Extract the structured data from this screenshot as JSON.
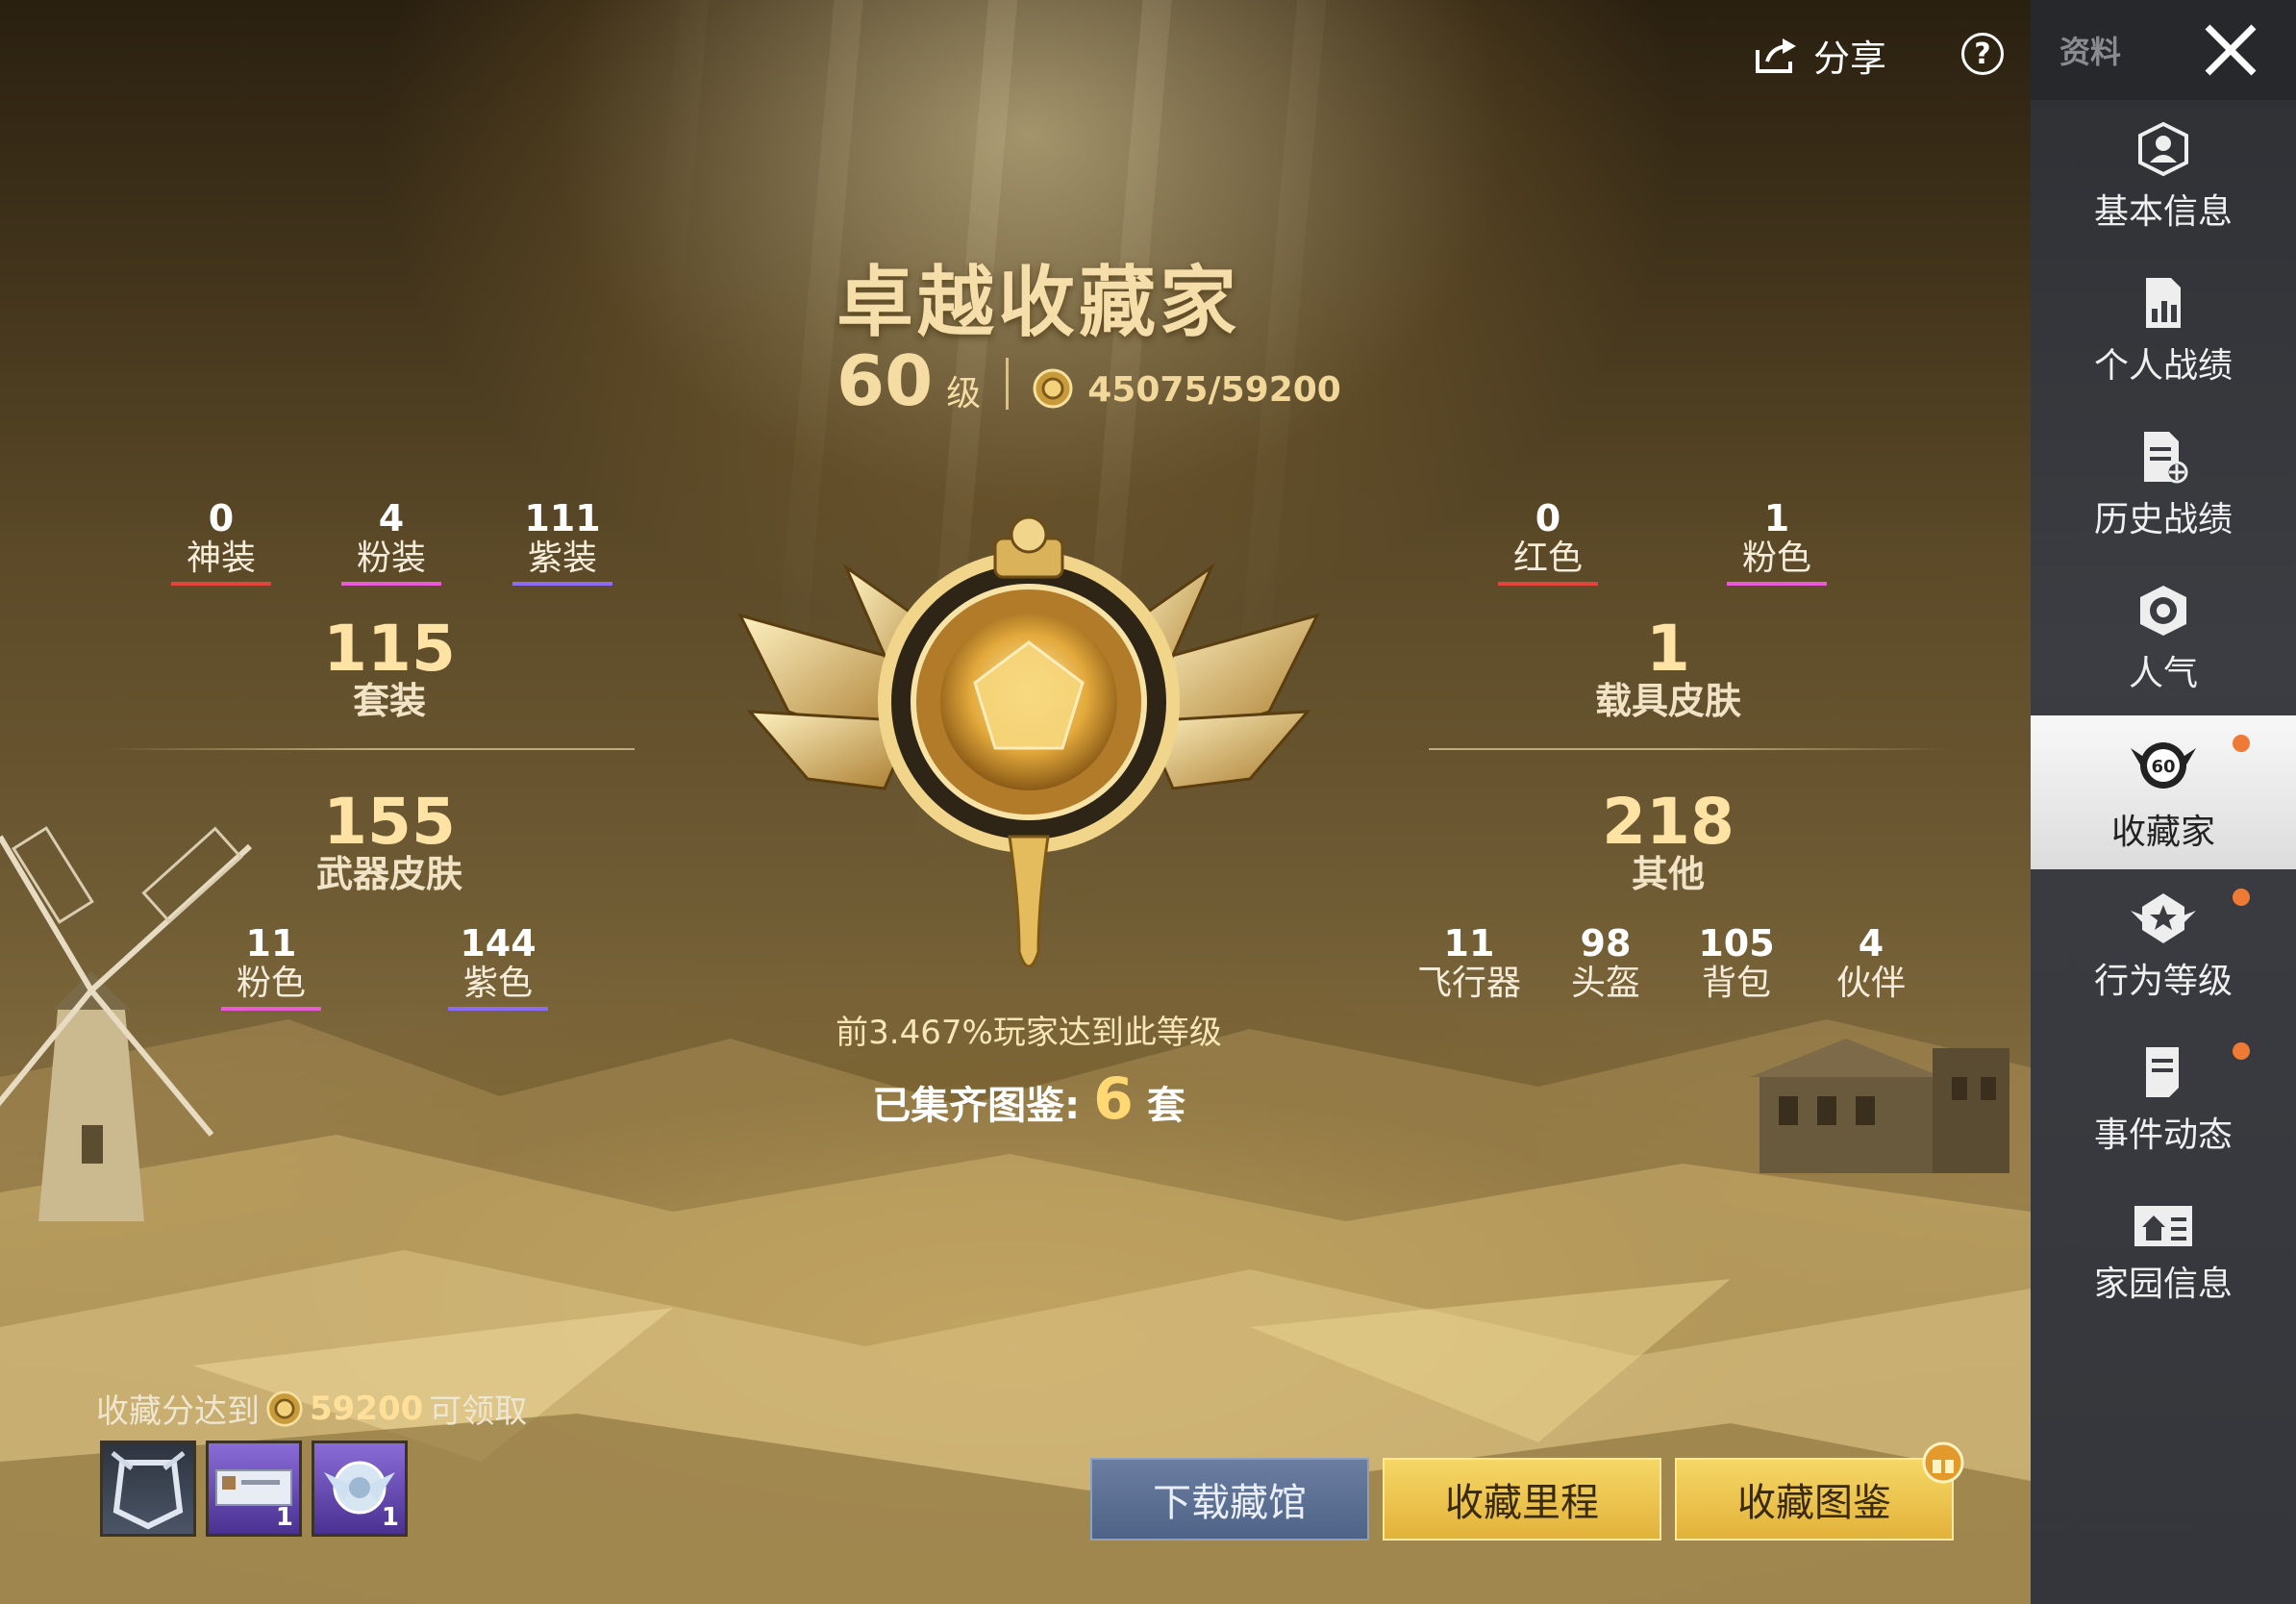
{
  "header": {
    "share_label": "分享",
    "help_label": "?"
  },
  "sidebar": {
    "top_label": "资料",
    "items": [
      {
        "label": "基本信息",
        "icon": "user-shield-icon",
        "active": false,
        "dot": false
      },
      {
        "label": "个人战绩",
        "icon": "stats-doc-icon",
        "active": false,
        "dot": false
      },
      {
        "label": "历史战绩",
        "icon": "history-doc-icon",
        "active": false,
        "dot": false
      },
      {
        "label": "人气",
        "icon": "popularity-icon",
        "active": false,
        "dot": false
      },
      {
        "label": "收藏家",
        "icon": "collector-badge-icon",
        "badge_num": "60",
        "active": true,
        "dot": true
      },
      {
        "label": "行为等级",
        "icon": "behavior-star-icon",
        "active": false,
        "dot": true
      },
      {
        "label": "事件动态",
        "icon": "event-doc-icon",
        "active": false,
        "dot": true
      },
      {
        "label": "家园信息",
        "icon": "home-icon",
        "active": false,
        "dot": false
      }
    ]
  },
  "main": {
    "title": "卓越收藏家",
    "level_num": "60",
    "level_unit": "级",
    "score": "45075/59200",
    "left": {
      "top_stats": [
        {
          "num": "0",
          "label": "神装",
          "color": "#e2453c"
        },
        {
          "num": "4",
          "label": "粉装",
          "color": "#e85ad6"
        },
        {
          "num": "111",
          "label": "紫装",
          "color": "#8b6cf2"
        }
      ],
      "suit": {
        "num": "115",
        "label": "套装"
      },
      "weapon": {
        "num": "155",
        "label": "武器皮肤"
      },
      "weapon_stats": [
        {
          "num": "11",
          "label": "粉色",
          "color": "#e85ad6"
        },
        {
          "num": "144",
          "label": "紫色",
          "color": "#8b6cf2"
        }
      ]
    },
    "right": {
      "top_stats": [
        {
          "num": "0",
          "label": "红色",
          "color": "#e2453c"
        },
        {
          "num": "1",
          "label": "粉色",
          "color": "#e85ad6"
        }
      ],
      "vehicle": {
        "num": "1",
        "label": "载具皮肤"
      },
      "other": {
        "num": "218",
        "label": "其他"
      },
      "other_stats": [
        {
          "num": "11",
          "label": "飞行器"
        },
        {
          "num": "98",
          "label": "头盔"
        },
        {
          "num": "105",
          "label": "背包"
        },
        {
          "num": "4",
          "label": "伙伴"
        }
      ]
    },
    "rank_text": "前3.467%玩家达到此等级",
    "collected_prefix": "已集齐图鉴:",
    "collected_num": "6",
    "collected_suffix": "套"
  },
  "reward": {
    "prefix": "收藏分达到",
    "amount": "59200",
    "suffix": "可领取",
    "items": [
      {
        "name": "avatar-frame-item",
        "count": ""
      },
      {
        "name": "name-card-item",
        "count": "1"
      },
      {
        "name": "emblem-item",
        "count": "1"
      }
    ]
  },
  "buttons": {
    "download": "下载藏馆",
    "milestone": "收藏里程",
    "catalog": "收藏图鉴"
  }
}
